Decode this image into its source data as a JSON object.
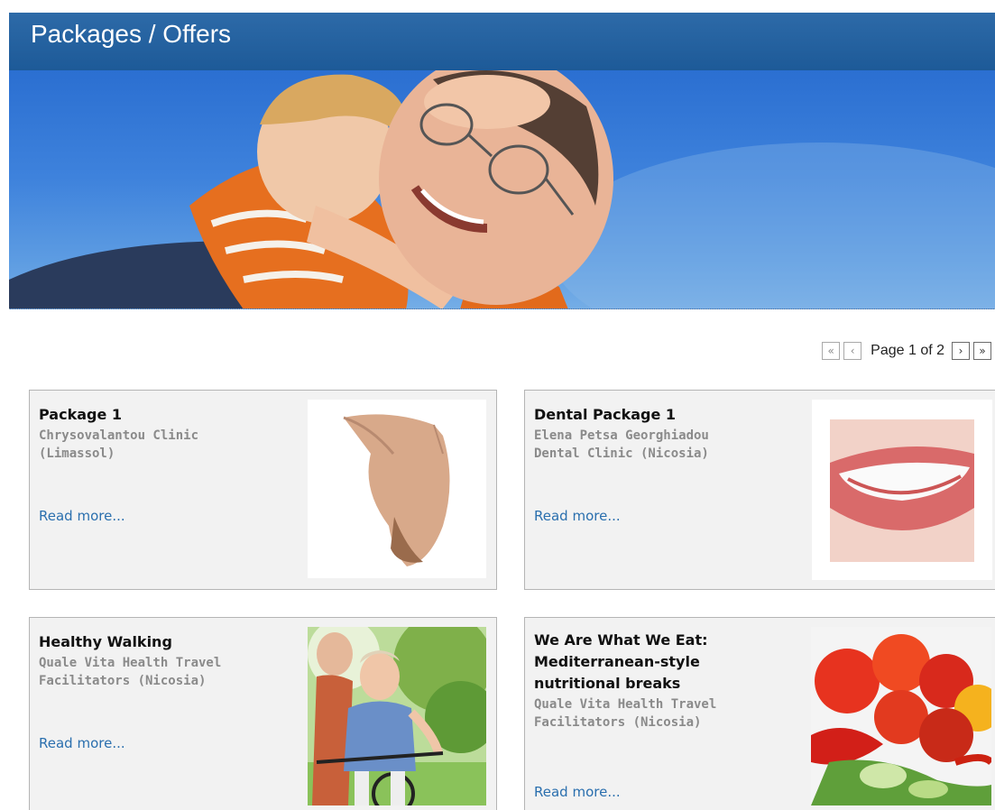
{
  "header": {
    "title": "Packages / Offers"
  },
  "pager": {
    "first": "«",
    "prev": "‹",
    "page_text": "Page 1 of 2",
    "next": "›",
    "last": "»"
  },
  "cards": [
    {
      "title": "Package 1",
      "provider_line1": "Chrysovalantou Clinic",
      "provider_line2": "(Limassol)",
      "link": "Read more...",
      "image": "back-torso-photo"
    },
    {
      "title": "Dental Package 1",
      "provider_line1": "Elena Petsa Georghiadou",
      "provider_line2": "Dental Clinic (Nicosia)",
      "link": "Read more...",
      "image": "smile-teeth-photo"
    },
    {
      "title": "Healthy Walking",
      "provider_line1": "Quale Vita Health Travel",
      "provider_line2": "Facilitators (Nicosia)",
      "link": "Read more...",
      "image": "elderly-couple-bicycle-photo"
    },
    {
      "title_line1": "We Are What We Eat:",
      "title_line2": "Mediterranean-style",
      "title_line3": "nutritional breaks",
      "provider_line1": "Quale Vita Health Travel",
      "provider_line2": "Facilitators (Nicosia)",
      "link": "Read more...",
      "image": "tomatoes-vegetables-photo"
    }
  ]
}
